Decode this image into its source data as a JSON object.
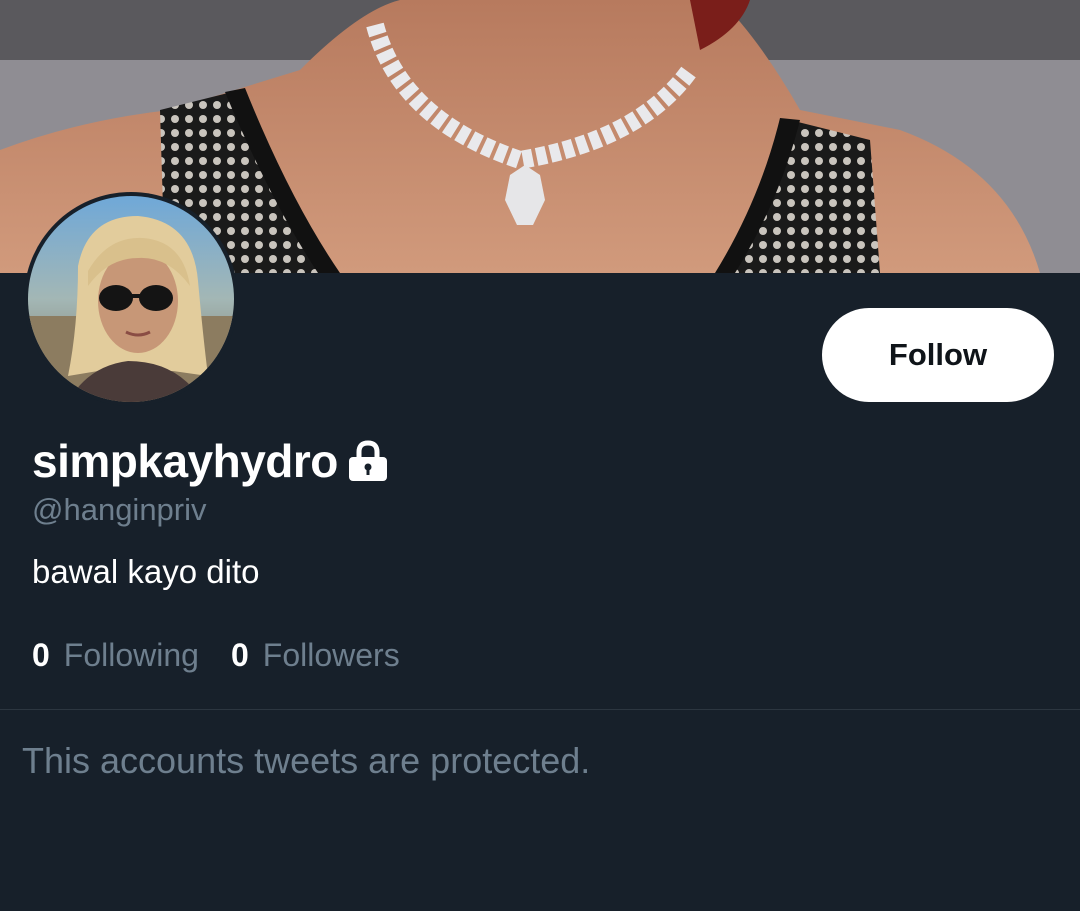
{
  "profile": {
    "display_name": "simpkayhydro",
    "handle": "@hanginpriv",
    "bio": "bawal kayo dito",
    "locked_icon": "lock-icon",
    "follow_label": "Follow"
  },
  "stats": {
    "following_count": "0",
    "following_label": "Following",
    "followers_count": "0",
    "followers_label": "Followers"
  },
  "timeline": {
    "protected_message": "This accounts tweets are protected."
  },
  "colors": {
    "background": "#17202a",
    "secondary_text": "#6e7f8e",
    "button_bg": "#ffffff"
  }
}
